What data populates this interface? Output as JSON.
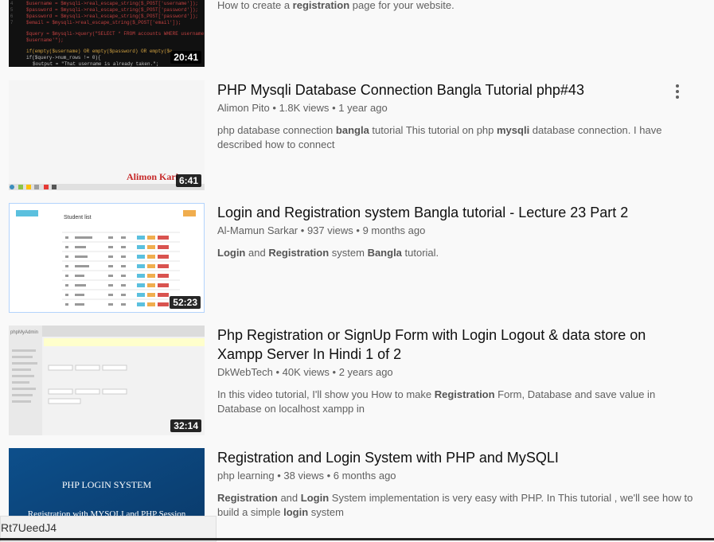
{
  "videos": [
    {
      "title": "",
      "channel": "",
      "views": "",
      "age": "",
      "description_parts": [
        {
          "t": "How to create a ",
          "b": false
        },
        {
          "t": "registration",
          "b": true
        },
        {
          "t": " page for your website.",
          "b": false
        }
      ],
      "duration": "20:41"
    },
    {
      "title": "PHP Mysqli Database Connection Bangla Tutorial php#43",
      "channel": "Alimon Pito",
      "views": "1.8K views",
      "age": "1 year ago",
      "description_parts": [
        {
          "t": "php database connection ",
          "b": false
        },
        {
          "t": "bangla",
          "b": true
        },
        {
          "t": " tutorial This tutorial on php ",
          "b": false
        },
        {
          "t": "mysqli",
          "b": true
        },
        {
          "t": " database connection. I have described how to connect",
          "b": false
        }
      ],
      "duration": "6:41",
      "thumb_text": "Alimon Kari"
    },
    {
      "title": "Login and Registration system Bangla tutorial - Lecture 23 Part 2",
      "channel": "Al-Mamun Sarkar",
      "views": "937 views",
      "age": "9 months ago",
      "description_parts": [
        {
          "t": "Login",
          "b": true
        },
        {
          "t": " and ",
          "b": false
        },
        {
          "t": "Registration",
          "b": true
        },
        {
          "t": " system ",
          "b": false
        },
        {
          "t": "Bangla",
          "b": true
        },
        {
          "t": " tutorial.",
          "b": false
        }
      ],
      "duration": "52:23",
      "thumb_text": "Student list"
    },
    {
      "title": "Php Registration or SignUp Form with Login Logout & data store on Xampp Server In Hindi 1 of 2",
      "channel": "DkWebTech",
      "views": "40K views",
      "age": "2 years ago",
      "description_parts": [
        {
          "t": "In this video tutorial, I'll show you How to make ",
          "b": false
        },
        {
          "t": "Registration",
          "b": true
        },
        {
          "t": " Form, Database and save value in Database on localhost xampp in",
          "b": false
        }
      ],
      "duration": "32:14"
    },
    {
      "title": "Registration and Login System with PHP and MySQLI",
      "channel": "php learning",
      "views": "38 views",
      "age": "6 months ago",
      "description_parts": [
        {
          "t": "Registration",
          "b": true
        },
        {
          "t": " and ",
          "b": false
        },
        {
          "t": "Login",
          "b": true
        },
        {
          "t": " System implementation is very easy with PHP. In This tutorial , we'll see how to build a simple ",
          "b": false
        },
        {
          "t": "login",
          "b": true
        },
        {
          "t": " system",
          "b": false
        }
      ],
      "duration": "",
      "thumb_text_1": "PHP LOGIN SYSTEM",
      "thumb_text_2": "Registration with MYSQLI and PHP Session"
    }
  ],
  "tooltip_text": "Rt7UeedJ4",
  "sep": "•"
}
